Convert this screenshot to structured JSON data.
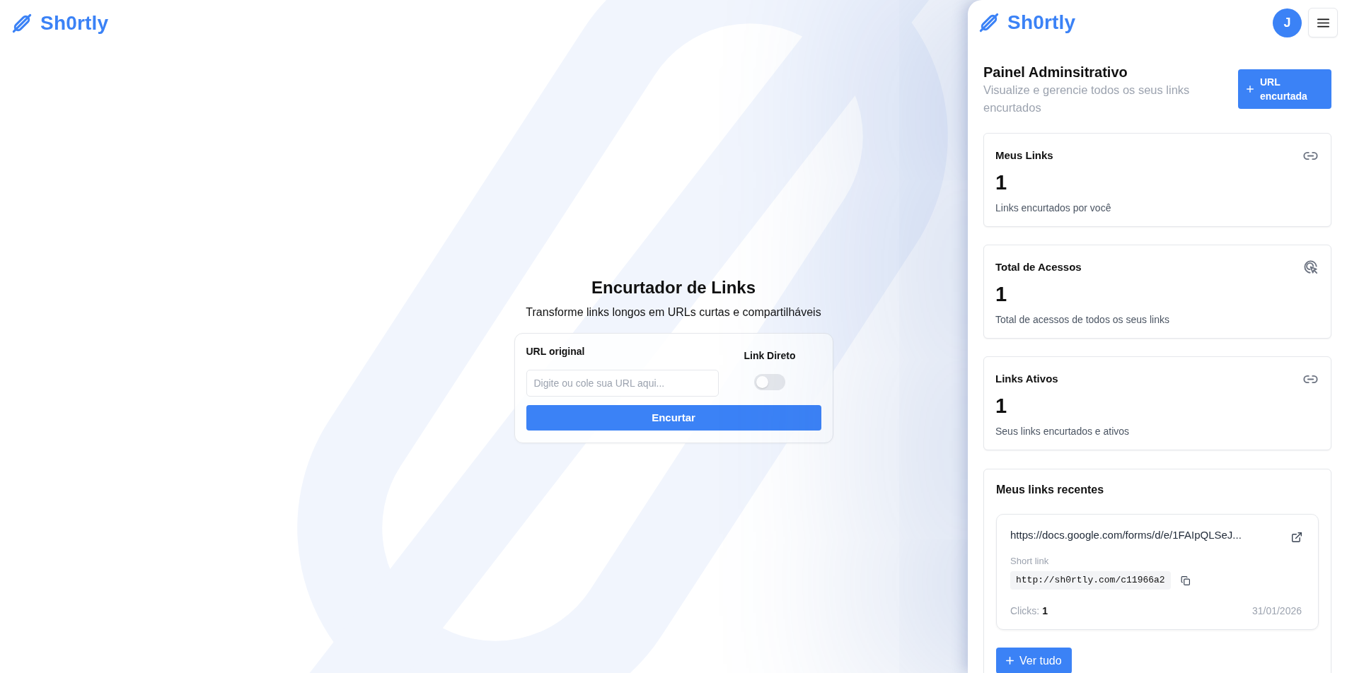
{
  "header": {
    "logo": "Sh0rtly"
  },
  "shortener": {
    "title": "Encurtador de Links",
    "subtitle": "Transforme links longos em URLs curtas e compartilháveis",
    "url_field": {
      "label": "URL original",
      "placeholder": "Digite ou cole sua URL aqui..."
    },
    "direct_link": {
      "label": "Link Direto",
      "on": false
    },
    "submit_button": "Encurtar"
  },
  "admin_panel": {
    "logo": "Sh0rtly",
    "avatar": "J",
    "title": "Painel Adminsitrativo",
    "subtitle": "Visualize e gerencie todos os seus links encurtados",
    "new_link_button": "URL encurtada",
    "stats": [
      {
        "kind": "link",
        "title": "Meus Links",
        "value": "1",
        "description": "Links encurtados por você"
      },
      {
        "kind": "click",
        "title": "Total de Acessos",
        "value": "1",
        "description": "Total de acessos de todos os seus links"
      },
      {
        "kind": "link",
        "title": "Links Ativos",
        "value": "1",
        "description": "Seus links encurtados e ativos"
      }
    ],
    "recent": {
      "title": "Meus links recentes",
      "links": [
        {
          "original_url": "https://docs.google.com/forms/d/e/1FAIpQLSeJ...",
          "short_link_label": "Short link",
          "short_url": "http://sh0rtly.com/c11966a2",
          "clicks_label": "Clicks:",
          "clicks": "1",
          "date": "31/01/2026"
        }
      ],
      "view_all_button": "Ver tudo"
    }
  }
}
